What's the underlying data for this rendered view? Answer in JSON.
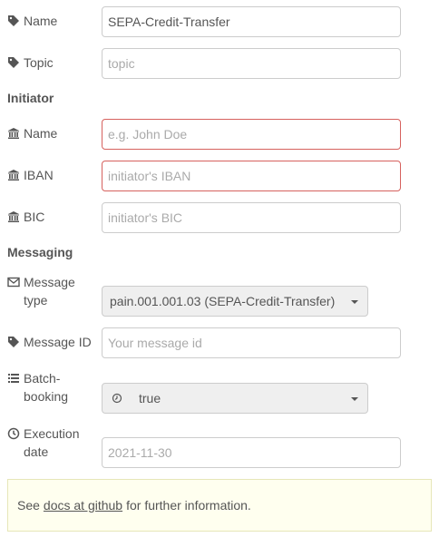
{
  "general": {
    "name_label": "Name",
    "name_value": "SEPA-Credit-Transfer",
    "topic_label": "Topic",
    "topic_placeholder": "topic"
  },
  "initiator": {
    "heading": "Initiator",
    "name_label": "Name",
    "name_placeholder": "e.g. John Doe",
    "iban_label": "IBAN",
    "iban_placeholder": "initiator's IBAN",
    "bic_label": "BIC",
    "bic_placeholder": "initiator's BIC"
  },
  "messaging": {
    "heading": "Messaging",
    "message_type_label_line1": "Message",
    "message_type_label_line2": "type",
    "message_type_value": "pain.001.001.03 (SEPA-Credit-Transfer)",
    "message_id_label": "Message ID",
    "message_id_placeholder": "Your message id",
    "batch_label_line1": "Batch-",
    "batch_label_line2": "booking",
    "batch_value": "true",
    "execution_label_line1": "Execution",
    "execution_label_line2": "date",
    "execution_value": "2021-11-30"
  },
  "info": {
    "prefix": "See",
    "link_text": "docs at github",
    "suffix": "for further information."
  },
  "colors": {
    "invalid_border": "#d6615e",
    "info_background": "#ffffef"
  },
  "icons": {
    "tag": "tag-icon",
    "bank": "bank-icon",
    "envelope": "envelope-icon",
    "list": "list-icon",
    "clock": "clock-icon",
    "caret": "caret-down-icon"
  }
}
